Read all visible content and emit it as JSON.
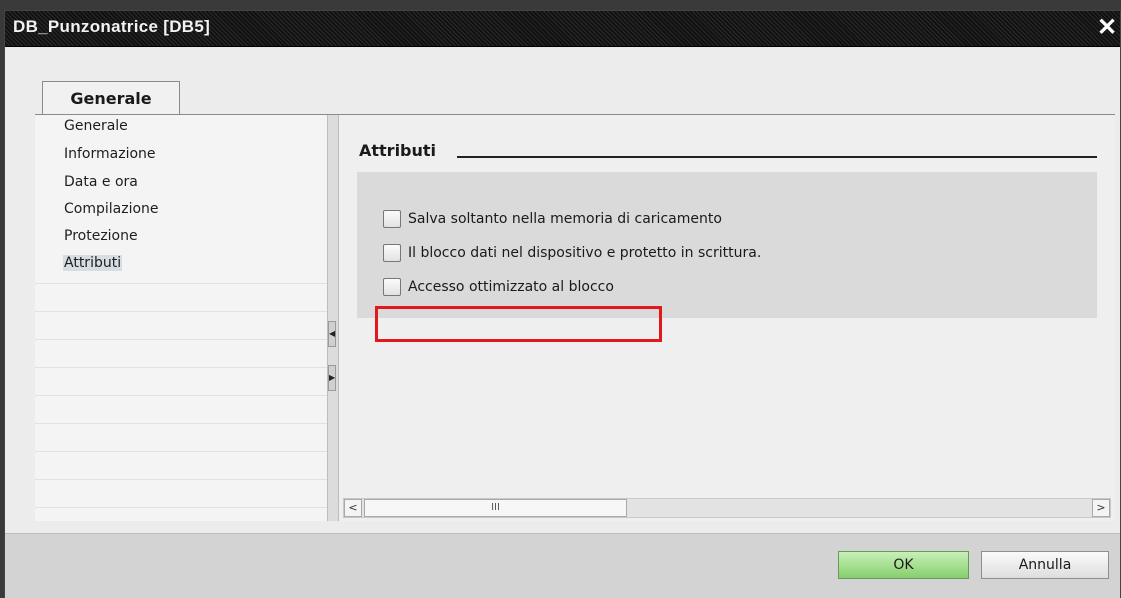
{
  "window": {
    "title": "DB_Punzonatrice [DB5]",
    "close_glyph": "✕"
  },
  "tab": {
    "label": "Generale"
  },
  "nav": {
    "items": [
      {
        "label": "Generale"
      },
      {
        "label": "Informazione"
      },
      {
        "label": "Data e ora"
      },
      {
        "label": "Compilazione"
      },
      {
        "label": "Protezione"
      },
      {
        "label": "Attributi",
        "selected": true
      }
    ]
  },
  "panel": {
    "section_title": "Attributi",
    "options": [
      {
        "label": "Salva soltanto nella memoria di caricamento",
        "checked": false
      },
      {
        "label": "Il blocco dati nel dispositivo e protetto in scrittura.",
        "checked": false
      },
      {
        "label": "Accesso ottimizzato al blocco",
        "checked": false,
        "highlighted": true
      }
    ]
  },
  "scrollbar": {
    "left_arrow": "<",
    "right_arrow": ">",
    "thumb_grip": "III"
  },
  "footer": {
    "ok_label": "OK",
    "cancel_label": "Annulla"
  },
  "colors": {
    "highlight": "#e3181d",
    "ok_button": "#86cf6d",
    "selected_nav": "#d6dde3"
  }
}
